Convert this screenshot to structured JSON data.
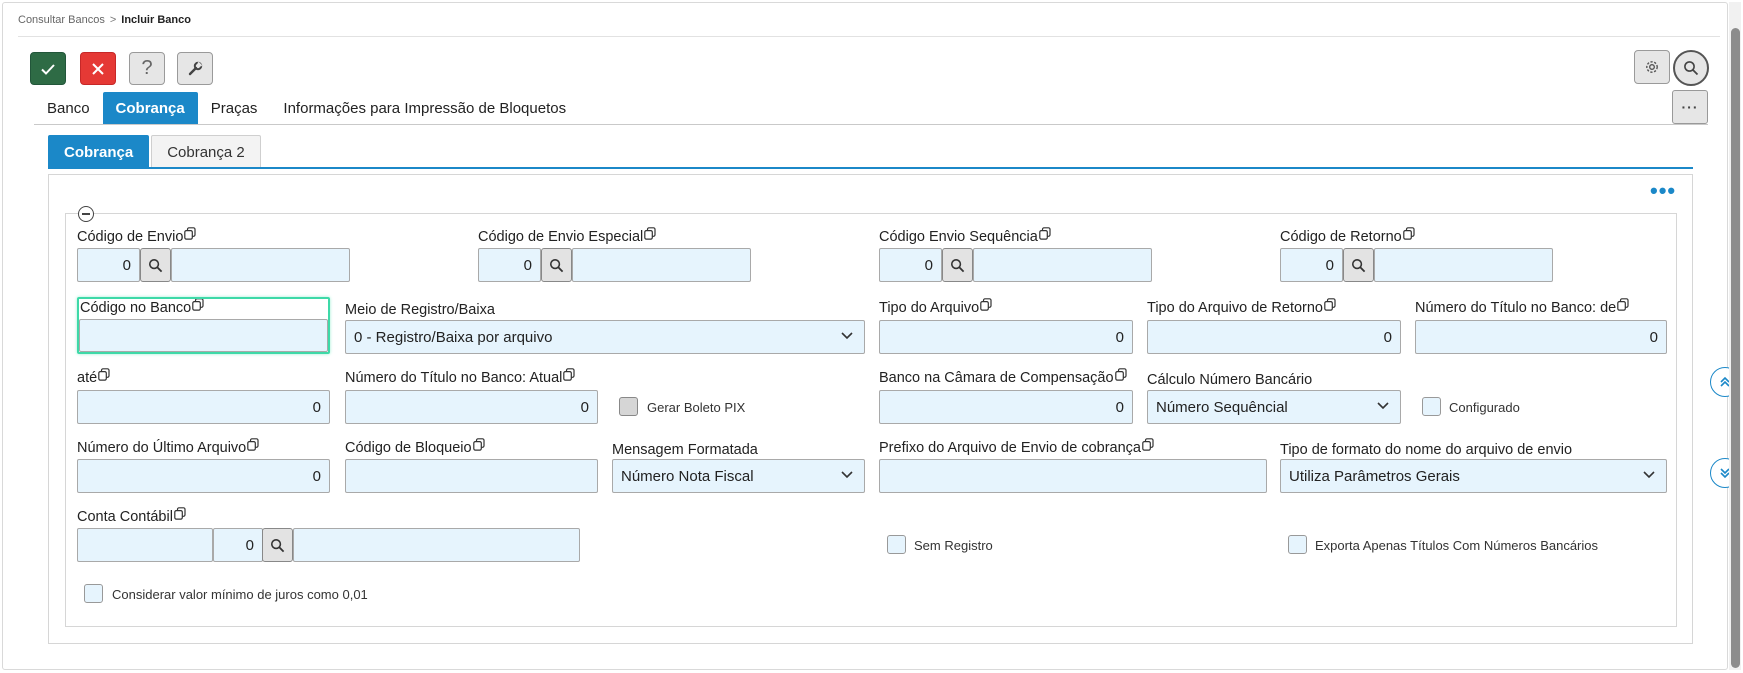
{
  "breadcrumb": {
    "parent": "Consultar Bancos",
    "separator": ">",
    "current": "Incluir Banco"
  },
  "toolbar": {
    "confirm_glyph": "✓",
    "cancel_glyph": "✕",
    "help_glyph": "?"
  },
  "main_tabs": [
    {
      "label": "Banco"
    },
    {
      "label": "Cobrança"
    },
    {
      "label": "Praças"
    },
    {
      "label": "Informações para Impressão de Bloquetos"
    }
  ],
  "more_glyph": "···",
  "sub_tabs": [
    {
      "label": "Cobrança"
    },
    {
      "label": "Cobrança 2"
    }
  ],
  "panel_more_glyph": "•••",
  "fields": {
    "codigo_envio": {
      "label": "Código de Envio",
      "value": "0"
    },
    "codigo_envio_especial": {
      "label": "Código de Envio Especial",
      "value": "0"
    },
    "codigo_envio_sequencia": {
      "label": "Código Envio Sequência",
      "value": "0"
    },
    "codigo_retorno": {
      "label": "Código de Retorno",
      "value": "0"
    },
    "codigo_no_banco": {
      "label": "Código no Banco",
      "value": ""
    },
    "meio_registro": {
      "label": "Meio de Registro/Baixa",
      "value": "0 - Registro/Baixa por arquivo"
    },
    "tipo_arquivo": {
      "label": "Tipo do Arquivo",
      "value": "0"
    },
    "tipo_arquivo_retorno": {
      "label": "Tipo do Arquivo de Retorno",
      "value": "0"
    },
    "numero_titulo_de": {
      "label": "Número do Título no Banco: de",
      "value": "0"
    },
    "ate": {
      "label": "até",
      "value": "0"
    },
    "numero_titulo_atual": {
      "label": "Número do Título no Banco: Atual",
      "value": "0"
    },
    "gerar_boleto_pix": {
      "label": "Gerar Boleto PIX"
    },
    "banco_camara": {
      "label": "Banco na Câmara de Compensação",
      "value": "0"
    },
    "calculo_numero": {
      "label": "Cálculo Número Bancário",
      "value": "Número Sequêncial"
    },
    "configurado": {
      "label": "Configurado"
    },
    "numero_ultimo_arquivo": {
      "label": "Número do Último Arquivo",
      "value": "0"
    },
    "codigo_bloqueio": {
      "label": "Código de Bloqueio",
      "value": ""
    },
    "mensagem_formatada": {
      "label": "Mensagem Formatada",
      "value": "Número Nota Fiscal"
    },
    "prefixo_arquivo": {
      "label": "Prefixo do Arquivo de Envio de cobrança",
      "value": ""
    },
    "tipo_formato_nome": {
      "label": "Tipo de formato do nome do arquivo de envio",
      "value": "Utiliza Parâmetros Gerais"
    },
    "conta_contabil": {
      "label": "Conta Contábil",
      "value": "",
      "code": "0"
    },
    "sem_registro": {
      "label": "Sem Registro"
    },
    "exporta_apenas": {
      "label": "Exporta Apenas Títulos Com Números Bancários"
    },
    "considerar_juros": {
      "label": "Considerar valor mínimo de juros como 0,01"
    }
  },
  "colors": {
    "accent": "#1b88c8",
    "confirm": "#2e6b45",
    "cancel": "#e53935",
    "input_bg": "#e6f4fd",
    "focus": "#3ed9a8"
  }
}
